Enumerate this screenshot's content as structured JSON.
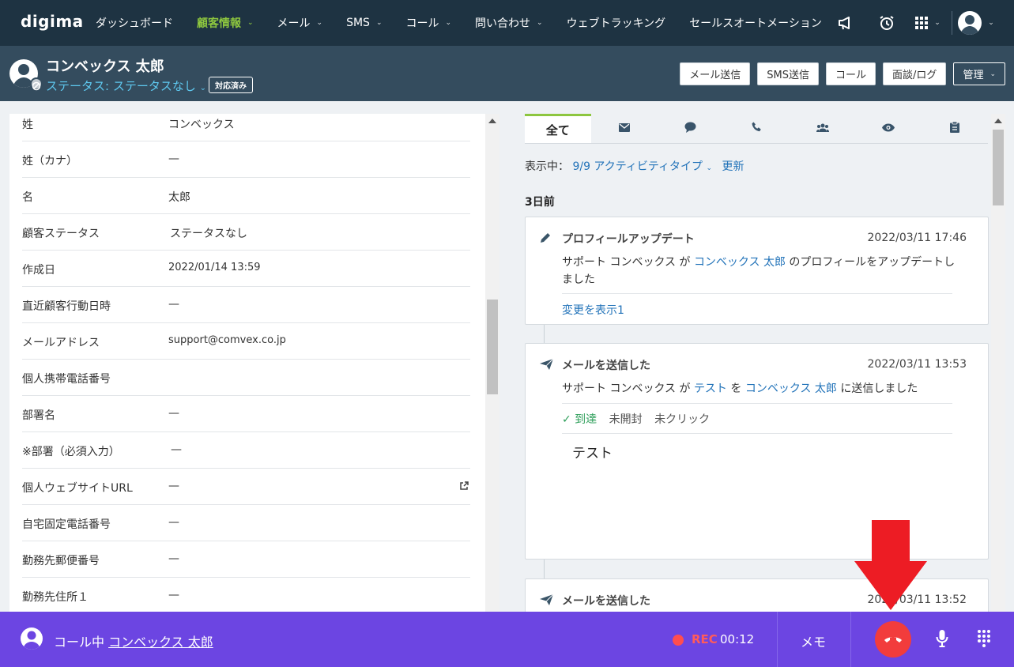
{
  "nav": {
    "logo": "digima",
    "items": [
      {
        "label": "ダッシュボード",
        "caret": false,
        "active": false
      },
      {
        "label": "顧客情報",
        "caret": true,
        "active": true
      },
      {
        "label": "メール",
        "caret": true,
        "active": false
      },
      {
        "label": "SMS",
        "caret": true,
        "active": false
      },
      {
        "label": "コール",
        "caret": true,
        "active": false
      },
      {
        "label": "問い合わせ",
        "caret": true,
        "active": false
      },
      {
        "label": "ウェブトラッキング",
        "caret": false,
        "active": false
      },
      {
        "label": "セールスオートメーション",
        "caret": false,
        "active": false
      }
    ],
    "icons": [
      "megaphone-icon",
      "alarm-clock-icon",
      "grid-apps-icon",
      "user-avatar-icon"
    ]
  },
  "header": {
    "name": "コンベックス 太郎",
    "status": "ステータス: ステータスなし",
    "badge": "対応済み",
    "buttons": {
      "email": "メール送信",
      "sms": "SMS送信",
      "call": "コール",
      "meeting": "面談/ログ",
      "manage": "管理"
    }
  },
  "fields": [
    {
      "label": "姓",
      "value": "コンベックス"
    },
    {
      "label": "姓（カナ）",
      "value": "—"
    },
    {
      "label": "名",
      "value": "太郎"
    },
    {
      "label": "顧客ステータス",
      "value": "ステータスなし"
    },
    {
      "label": "作成日",
      "value": "2022/01/14 13:59"
    },
    {
      "label": "直近顧客行動日時",
      "value": "—"
    },
    {
      "label": "メールアドレス",
      "value": "support@comvex.co.jp"
    },
    {
      "label": "個人携帯電話番号",
      "value": ""
    },
    {
      "label": "部署名",
      "value": "—"
    },
    {
      "label": "※部署（必須入力）",
      "value": "—"
    },
    {
      "label": "個人ウェブサイトURL",
      "value": "—"
    },
    {
      "label": "自宅固定電話番号",
      "value": "—"
    },
    {
      "label": "勤務先郵便番号",
      "value": "—"
    },
    {
      "label": "勤務先住所１",
      "value": "—"
    }
  ],
  "activity": {
    "tabs": {
      "all": "全て"
    },
    "showing_label": "表示中：",
    "filter": "9/9 アクティビティタイプ",
    "refresh": "更新",
    "day": "3日前",
    "cards": [
      {
        "title": "プロフィールアップデート",
        "time": "2022/03/11 17:46",
        "text_a": "サポート コンベックス が ",
        "link_a": "コンベックス 太郎",
        "text_b": " のプロフィールをアップデートしました",
        "link": "変更を表示1"
      },
      {
        "title": "メールを送信した",
        "time": "2022/03/11 13:53",
        "text_a": "サポート コンベックス が ",
        "link_a": "テスト",
        "text_b": " を ",
        "link_b": "コンベックス 太郎",
        "text_c": " に送信しました",
        "delivered": "✓ 到達",
        "unopened": "未開封",
        "unclicked": "未クリック",
        "content": "テスト"
      },
      {
        "title": "メールを送信した",
        "time": "2022/03/11 13:52"
      }
    ]
  },
  "callbar": {
    "prefix": "コール中 ",
    "name": "コンベックス 太郎",
    "rec": "REC",
    "time": "00:12",
    "memo": "メモ"
  },
  "colors": {
    "nav_bg": "#1e3342",
    "sub_bg": "#344c5e",
    "accent_green": "#8dc63f",
    "link": "#2273b9",
    "callbar": "#6c45e2",
    "hangup": "#f23c3c",
    "annotation_arrow": "#ed1c24"
  }
}
